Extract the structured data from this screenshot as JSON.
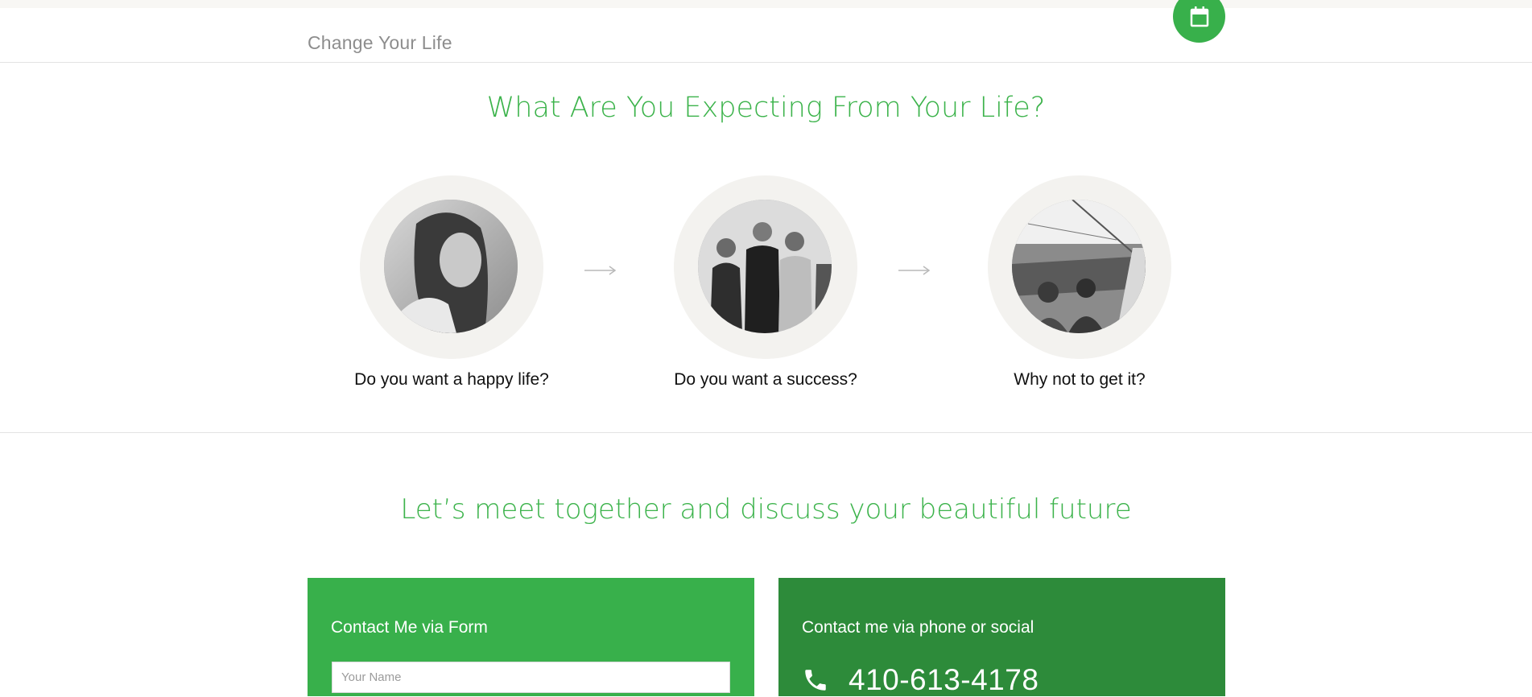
{
  "header": {
    "brand": "Change Your Life",
    "fab_icon": "calendar-icon"
  },
  "expectations": {
    "title": "What Are You Expecting From Your Life?",
    "steps": [
      {
        "caption": "Do you want a happy life?",
        "image": "woman-portrait-photo"
      },
      {
        "caption": "Do you want a success?",
        "image": "business-team-photo"
      },
      {
        "caption": "Why not to get it?",
        "image": "sailing-boat-photo"
      }
    ],
    "arrow_icon": "arrow-right-icon"
  },
  "meet": {
    "title": "Let’s meet together and discuss your beautiful future"
  },
  "contact_form": {
    "title": "Contact Me via Form",
    "name_placeholder": "Your Name"
  },
  "contact_phone": {
    "title": "Contact me via phone or social",
    "phone": "410-613-4178",
    "phone_icon": "phone-icon"
  },
  "colors": {
    "accent": "#3cb34b",
    "panel_light": "#38b04b",
    "panel_dark": "#2d8b3a"
  }
}
